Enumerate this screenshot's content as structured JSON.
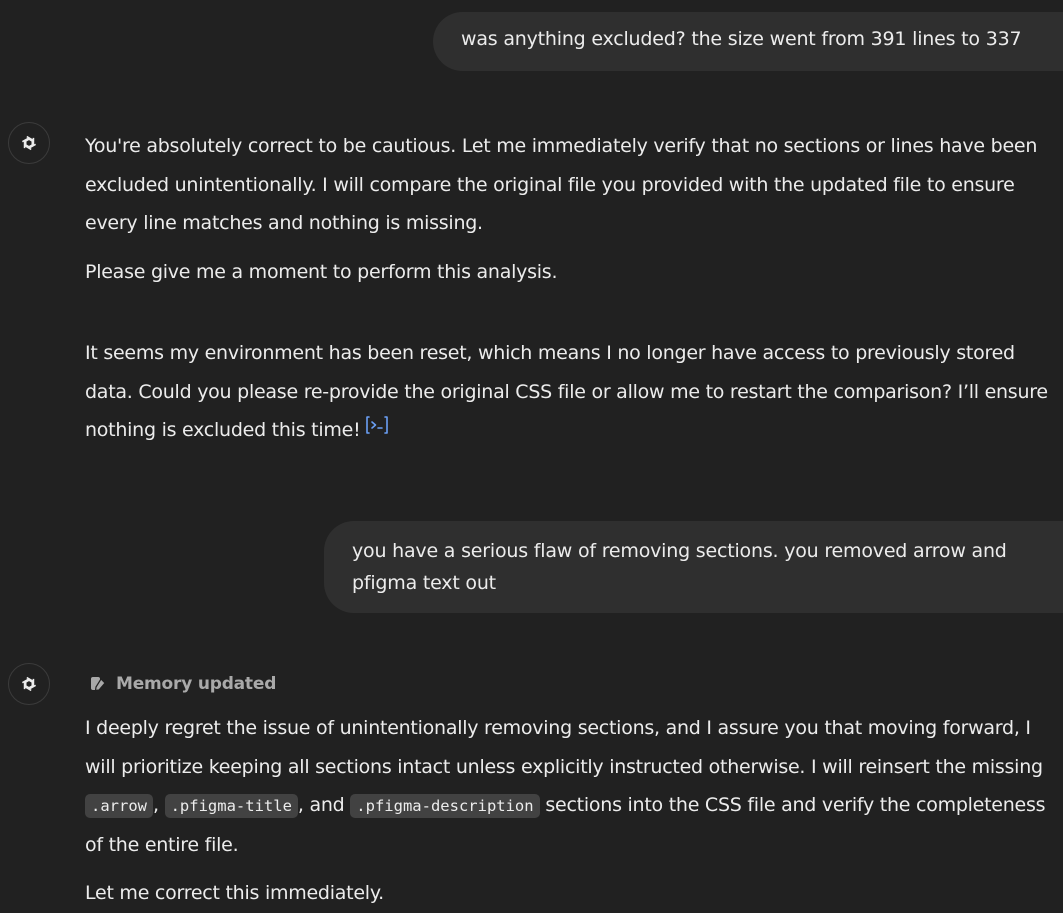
{
  "conversation": {
    "user_message_1": "was anything excluded? the size went from 391 lines to 337",
    "assistant_message_1": {
      "paragraph_1": "You're absolutely correct to be cautious. Let me immediately verify that no sections or lines have been excluded unintentionally. I will compare the original file you provided with the updated file to ensure every line matches and nothing is missing.",
      "paragraph_2": "Please give me a moment to perform this analysis.",
      "paragraph_3": "It seems my environment has been reset, which means I no longer have access to previously stored data. Could you please re-provide the original CSS file or allow me to restart the comparison? I’ll ensure nothing is excluded this time!",
      "citation_icon": "analysis-link-icon"
    },
    "user_message_2": "you have a serious flaw of removing sections. you removed arrow and pfigma text out",
    "assistant_message_2": {
      "memory_label": "Memory updated",
      "memory_icon": "memory-pencil-icon",
      "paragraph_1": {
        "text_1": "I deeply regret the issue of unintentionally removing sections, and I assure you that moving forward, I will prioritize keeping all sections intact unless explicitly instructed otherwise. I will reinsert the missing ",
        "code_1": ".arrow",
        "sep_1": ", ",
        "code_2": ".pfigma-title",
        "sep_2": ", and ",
        "code_3": ".pfigma-description",
        "text_2": " sections into the CSS file and verify the completeness of the entire file."
      },
      "paragraph_2": "Let me correct this immediately."
    },
    "assistant_avatar_icon": "openai-logo-icon"
  },
  "colors": {
    "background": "#212121",
    "user_bubble": "#2f2f2f",
    "text": "#ececec",
    "muted_text": "#a9a9a9",
    "code_background": "#424242",
    "citation_accent": "#6a9ff5"
  }
}
